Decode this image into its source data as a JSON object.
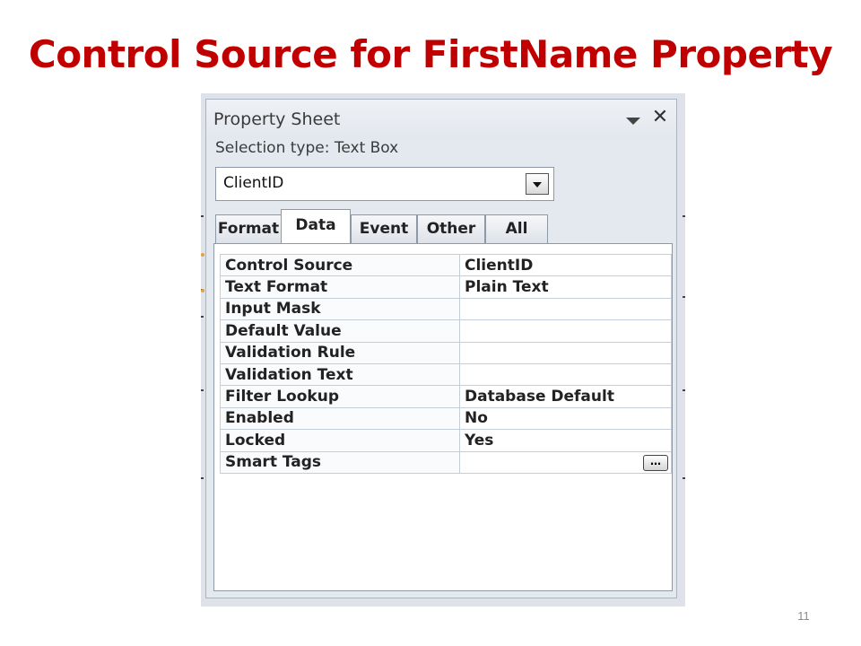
{
  "slide": {
    "title": "Control Source for FirstName Property",
    "page_number": "11",
    "title_color": "#c00000"
  },
  "property_sheet": {
    "title": "Property Sheet",
    "selection_type": "Selection type:  Text Box",
    "selected_control": "ClientID",
    "tabs": [
      {
        "label": "Format",
        "active": false
      },
      {
        "label": "Data",
        "active": true
      },
      {
        "label": "Event",
        "active": false
      },
      {
        "label": "Other",
        "active": false
      },
      {
        "label": "All",
        "active": false
      }
    ],
    "properties": [
      {
        "name": "Control Source",
        "value": "ClientID"
      },
      {
        "name": "Text Format",
        "value": "Plain Text"
      },
      {
        "name": "Input Mask",
        "value": ""
      },
      {
        "name": "Default Value",
        "value": ""
      },
      {
        "name": "Validation Rule",
        "value": ""
      },
      {
        "name": "Validation Text",
        "value": ""
      },
      {
        "name": "Filter Lookup",
        "value": "Database Default"
      },
      {
        "name": "Enabled",
        "value": "No"
      },
      {
        "name": "Locked",
        "value": "Yes"
      },
      {
        "name": "Smart Tags",
        "value": ""
      }
    ],
    "builder_button_label": "…"
  }
}
